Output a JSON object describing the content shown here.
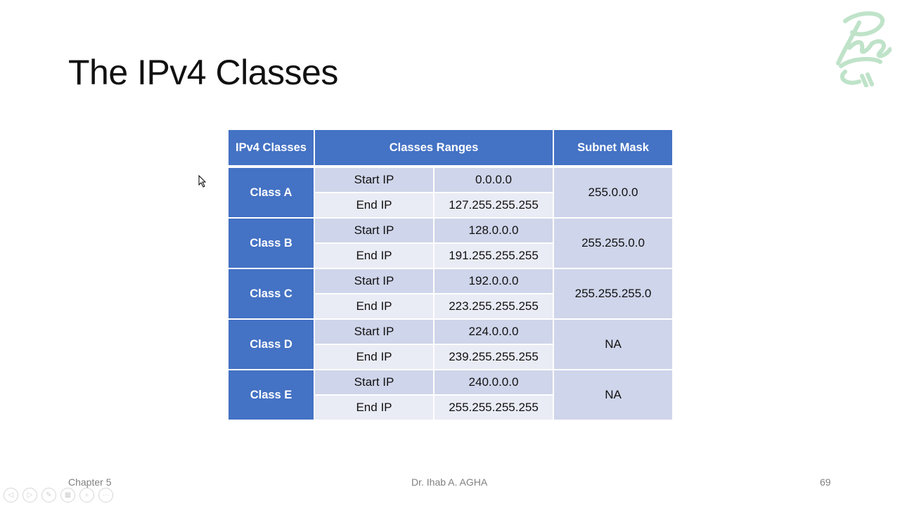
{
  "slide": {
    "title": "The IPv4 Classes",
    "logo_icon": "calligraphy-logo-icon",
    "accent_color": "#4472c4",
    "table": {
      "headers": [
        "IPv4 Classes",
        "Classes Ranges",
        "Subnet Mask"
      ],
      "rows": [
        {
          "class": "Class A",
          "start_label": "Start IP",
          "start": "0.0.0.0",
          "end_label": "End IP",
          "end": "127.255.255.255",
          "mask": "255.0.0.0"
        },
        {
          "class": "Class B",
          "start_label": "Start IP",
          "start": "128.0.0.0",
          "end_label": "End IP",
          "end": "191.255.255.255",
          "mask": "255.255.0.0"
        },
        {
          "class": "Class C",
          "start_label": "Start IP",
          "start": "192.0.0.0",
          "end_label": "End IP",
          "end": "223.255.255.255",
          "mask": "255.255.255.0"
        },
        {
          "class": "Class D",
          "start_label": "Start IP",
          "start": "224.0.0.0",
          "end_label": "End IP",
          "end": "239.255.255.255",
          "mask": "NA"
        },
        {
          "class": "Class E",
          "start_label": "Start IP",
          "start": "240.0.0.0",
          "end_label": "End IP",
          "end": "255.255.255.255",
          "mask": "NA"
        }
      ]
    },
    "footer": {
      "left": "Chapter 5",
      "center": "Dr. Ihab A. AGHA",
      "page_number": "69"
    }
  },
  "presenter_toolbar": {
    "buttons": [
      {
        "name": "previous-slide",
        "icon": "◁"
      },
      {
        "name": "next-slide",
        "icon": "▷"
      },
      {
        "name": "pen-tool",
        "icon": "✎"
      },
      {
        "name": "see-all-slides",
        "icon": "▦"
      },
      {
        "name": "zoom",
        "icon": "⌕"
      },
      {
        "name": "more-options",
        "icon": "···"
      }
    ]
  }
}
